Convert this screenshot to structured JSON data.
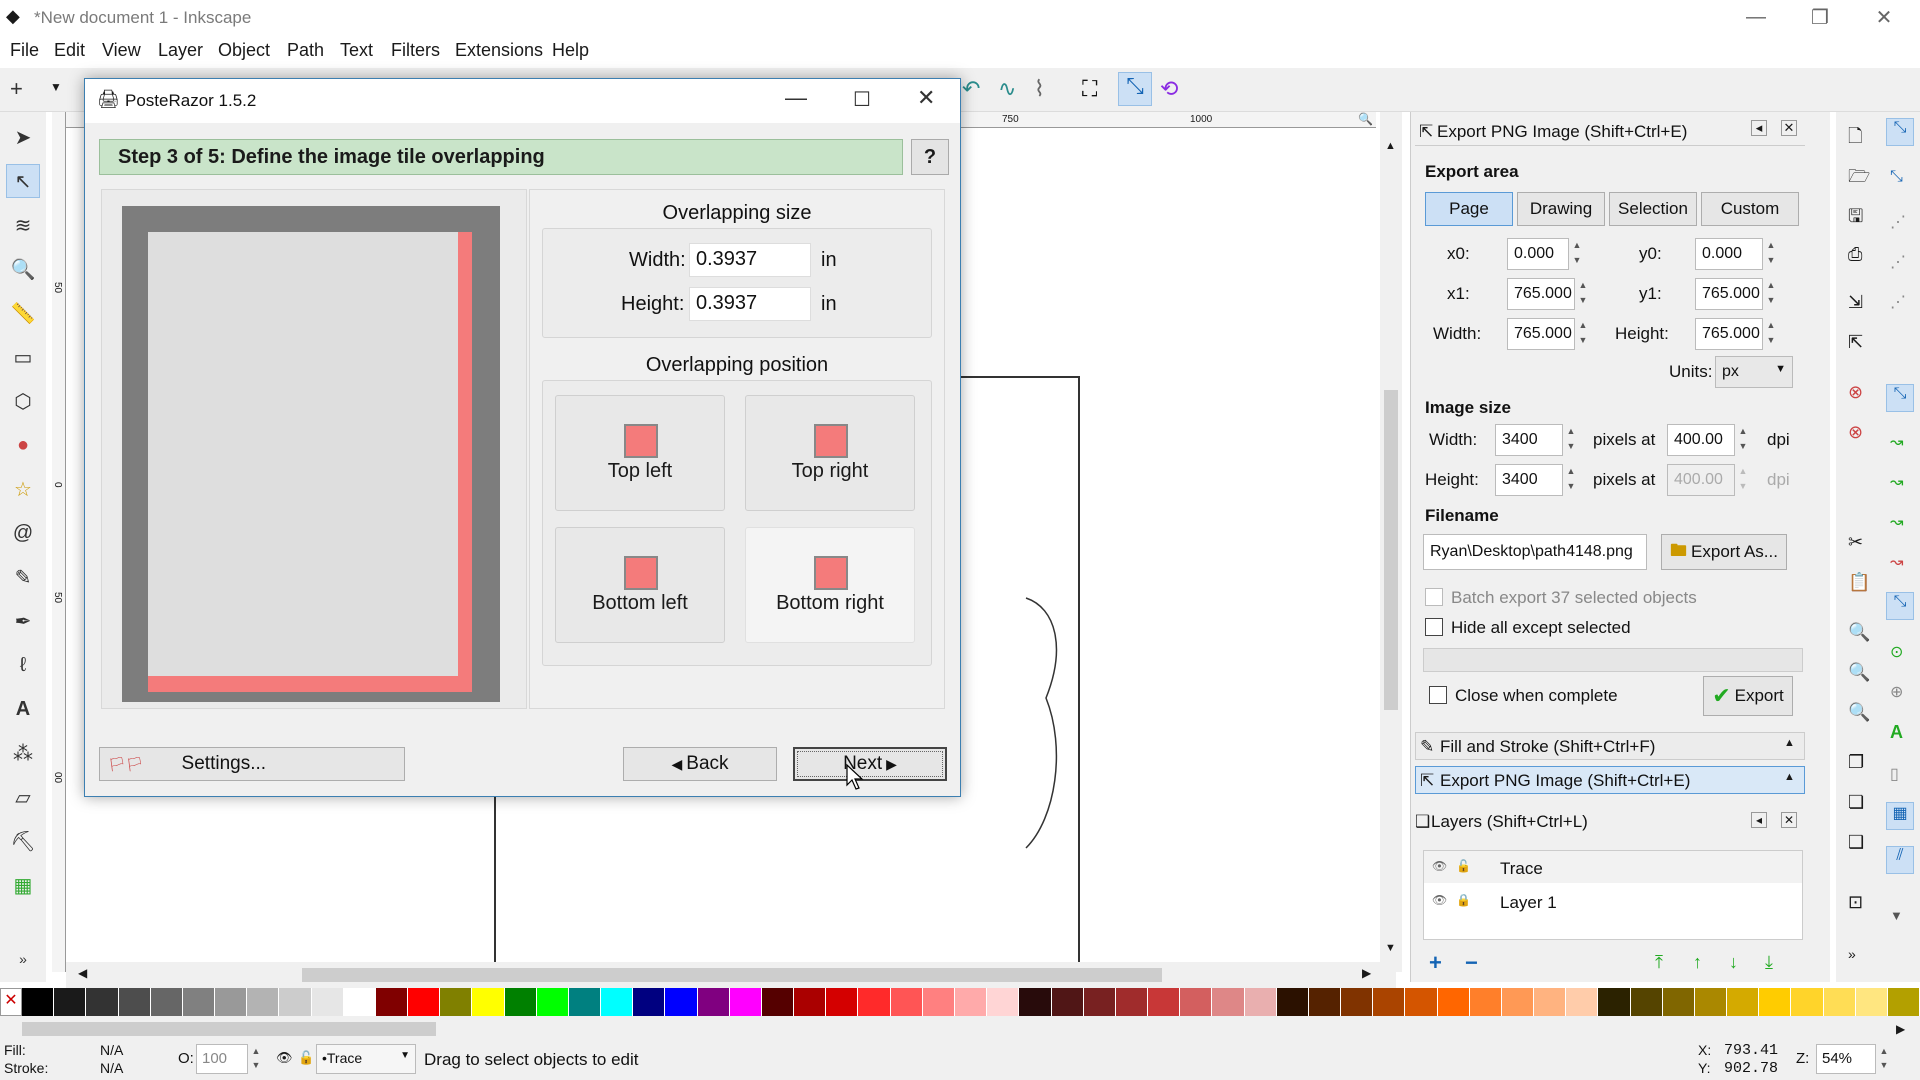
{
  "window": {
    "title": "*New document 1 - Inkscape"
  },
  "menu": [
    "File",
    "Edit",
    "View",
    "Layer",
    "Object",
    "Path",
    "Text",
    "Filters",
    "Extensions",
    "Help"
  ],
  "ruler": {
    "h_ticks": [
      "750",
      "1000"
    ],
    "v_ticks": [
      "50",
      "0",
      "50",
      "00"
    ]
  },
  "dialog": {
    "title": "PosteRazor 1.5.2",
    "step": "Step 3 of 5: Define the image tile overlapping",
    "help": "?",
    "overlap_size": {
      "heading": "Overlapping size",
      "width_label": "Width:",
      "width_value": "0.3937",
      "height_label": "Height:",
      "height_value": "0.3937",
      "unit": "in"
    },
    "overlap_position": {
      "heading": "Overlapping position",
      "options": [
        "Top left",
        "Top right",
        "Bottom left",
        "Bottom right"
      ]
    },
    "settings_label": "Settings...",
    "back_label": "Back",
    "next_label": "Next"
  },
  "export_panel": {
    "title": "Export PNG Image (Shift+Ctrl+E)",
    "export_area_heading": "Export area",
    "area_buttons": [
      "Page",
      "Drawing",
      "Selection",
      "Custom"
    ],
    "x0_label": "x0:",
    "x0": "0.000",
    "y0_label": "y0:",
    "y0": "0.000",
    "x1_label": "x1:",
    "x1": "765.000",
    "y1_label": "y1:",
    "y1": "765.000",
    "width_label": "Width:",
    "width": "765.000",
    "height_label": "Height:",
    "height": "765.000",
    "units_label": "Units:",
    "units": "px",
    "image_size_heading": "Image size",
    "img_width_label": "Width:",
    "img_width": "3400",
    "img_height_label": "Height:",
    "img_height": "3400",
    "pixels_at": "pixels at",
    "dpi_value": "400.00",
    "dpi_value2": "400.00",
    "dpi": "dpi",
    "filename_heading": "Filename",
    "filename": "Ryan\\Desktop\\path4148.png",
    "export_as": "Export As...",
    "batch_export": "Batch export 37 selected objects",
    "hide_all": "Hide all except selected",
    "close_when_complete": "Close when complete",
    "export": "Export"
  },
  "fill_stroke_tab": "Fill and Stroke (Shift+Ctrl+F)",
  "export_tab": "Export PNG Image (Shift+Ctrl+E)",
  "layers_panel": {
    "title": "Layers (Shift+Ctrl+L)",
    "layers": [
      "Trace",
      "Layer 1"
    ]
  },
  "status": {
    "fill_label": "Fill:",
    "fill_value": "N/A",
    "stroke_label": "Stroke:",
    "stroke_value": "N/A",
    "opacity_label": "O:",
    "opacity": "100",
    "layer": "•Trace",
    "message": "Drag to select objects to edit",
    "x_label": "X:",
    "x": "793.41",
    "y_label": "Y:",
    "y": "902.78",
    "zoom_label": "Z:",
    "zoom": "54%"
  },
  "palette": [
    "#000000",
    "#1a1a1a",
    "#333333",
    "#4d4d4d",
    "#666666",
    "#808080",
    "#999999",
    "#b3b3b3",
    "#cccccc",
    "#e6e6e6",
    "#ffffff",
    "#800000",
    "#ff0000",
    "#808000",
    "#ffff00",
    "#008000",
    "#00ff00",
    "#008080",
    "#00ffff",
    "#000080",
    "#0000ff",
    "#800080",
    "#ff00ff",
    "#550000",
    "#aa0000",
    "#d40000",
    "#ff2a2a",
    "#ff5555",
    "#ff8080",
    "#ffaaaa",
    "#ffd5d5",
    "#280b0b",
    "#501616",
    "#782121",
    "#a02c2c",
    "#c83737",
    "#d35f5f",
    "#de8787",
    "#e9afaf",
    "#2b1100",
    "#552200",
    "#803300",
    "#aa4400",
    "#d45500",
    "#ff6600",
    "#ff7f2a",
    "#ff9955",
    "#ffb380",
    "#ffccaa",
    "#2b2200",
    "#554400",
    "#806600",
    "#aa8800",
    "#d4aa00",
    "#ffcc00",
    "#ffd42a",
    "#ffdd55",
    "#ffe680",
    "#b3a000"
  ]
}
